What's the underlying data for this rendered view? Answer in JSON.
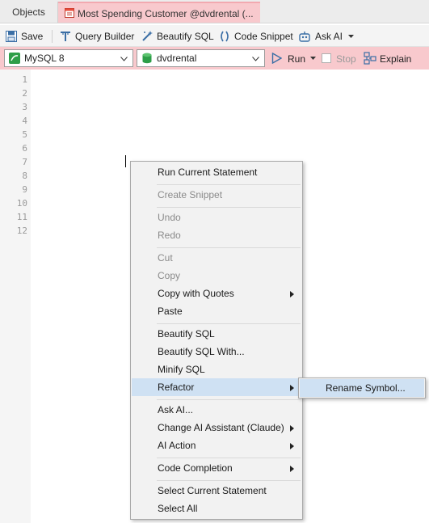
{
  "tabs": [
    {
      "label": "Objects"
    },
    {
      "label": "Most Spending Customer @dvdrental (..."
    }
  ],
  "toolbar": {
    "save": "Save",
    "query_builder": "Query Builder",
    "beautify_sql": "Beautify SQL",
    "code_snippet": "Code Snippet",
    "ask_ai": "Ask AI"
  },
  "connection_bar": {
    "db_type": "MySQL 8",
    "database": "dvdrental",
    "run": "Run",
    "stop": "Stop",
    "explain": "Explain"
  },
  "editor": {
    "line_numbers": [
      "1",
      "2",
      "3",
      "4",
      "5",
      "6",
      "7",
      "8",
      "9",
      "10",
      "11",
      "12"
    ]
  },
  "context_menu": {
    "run_current_statement": "Run Current Statement",
    "create_snippet": "Create Snippet",
    "undo": "Undo",
    "redo": "Redo",
    "cut": "Cut",
    "copy": "Copy",
    "copy_with_quotes": "Copy with Quotes",
    "paste": "Paste",
    "beautify_sql": "Beautify SQL",
    "beautify_sql_with": "Beautify SQL With...",
    "minify_sql": "Minify SQL",
    "refactor": "Refactor",
    "ask_ai": "Ask AI...",
    "change_ai_assistant": "Change AI Assistant (Claude)",
    "ai_action": "AI Action",
    "code_completion": "Code Completion",
    "select_current_statement": "Select Current Statement",
    "select_all": "Select All"
  },
  "submenu": {
    "rename_symbol": "Rename Symbol..."
  },
  "colors": {
    "tab_active": "#f8c9cd",
    "keyword": "#2255cc",
    "menu_highlight": "#cfe1f3"
  }
}
